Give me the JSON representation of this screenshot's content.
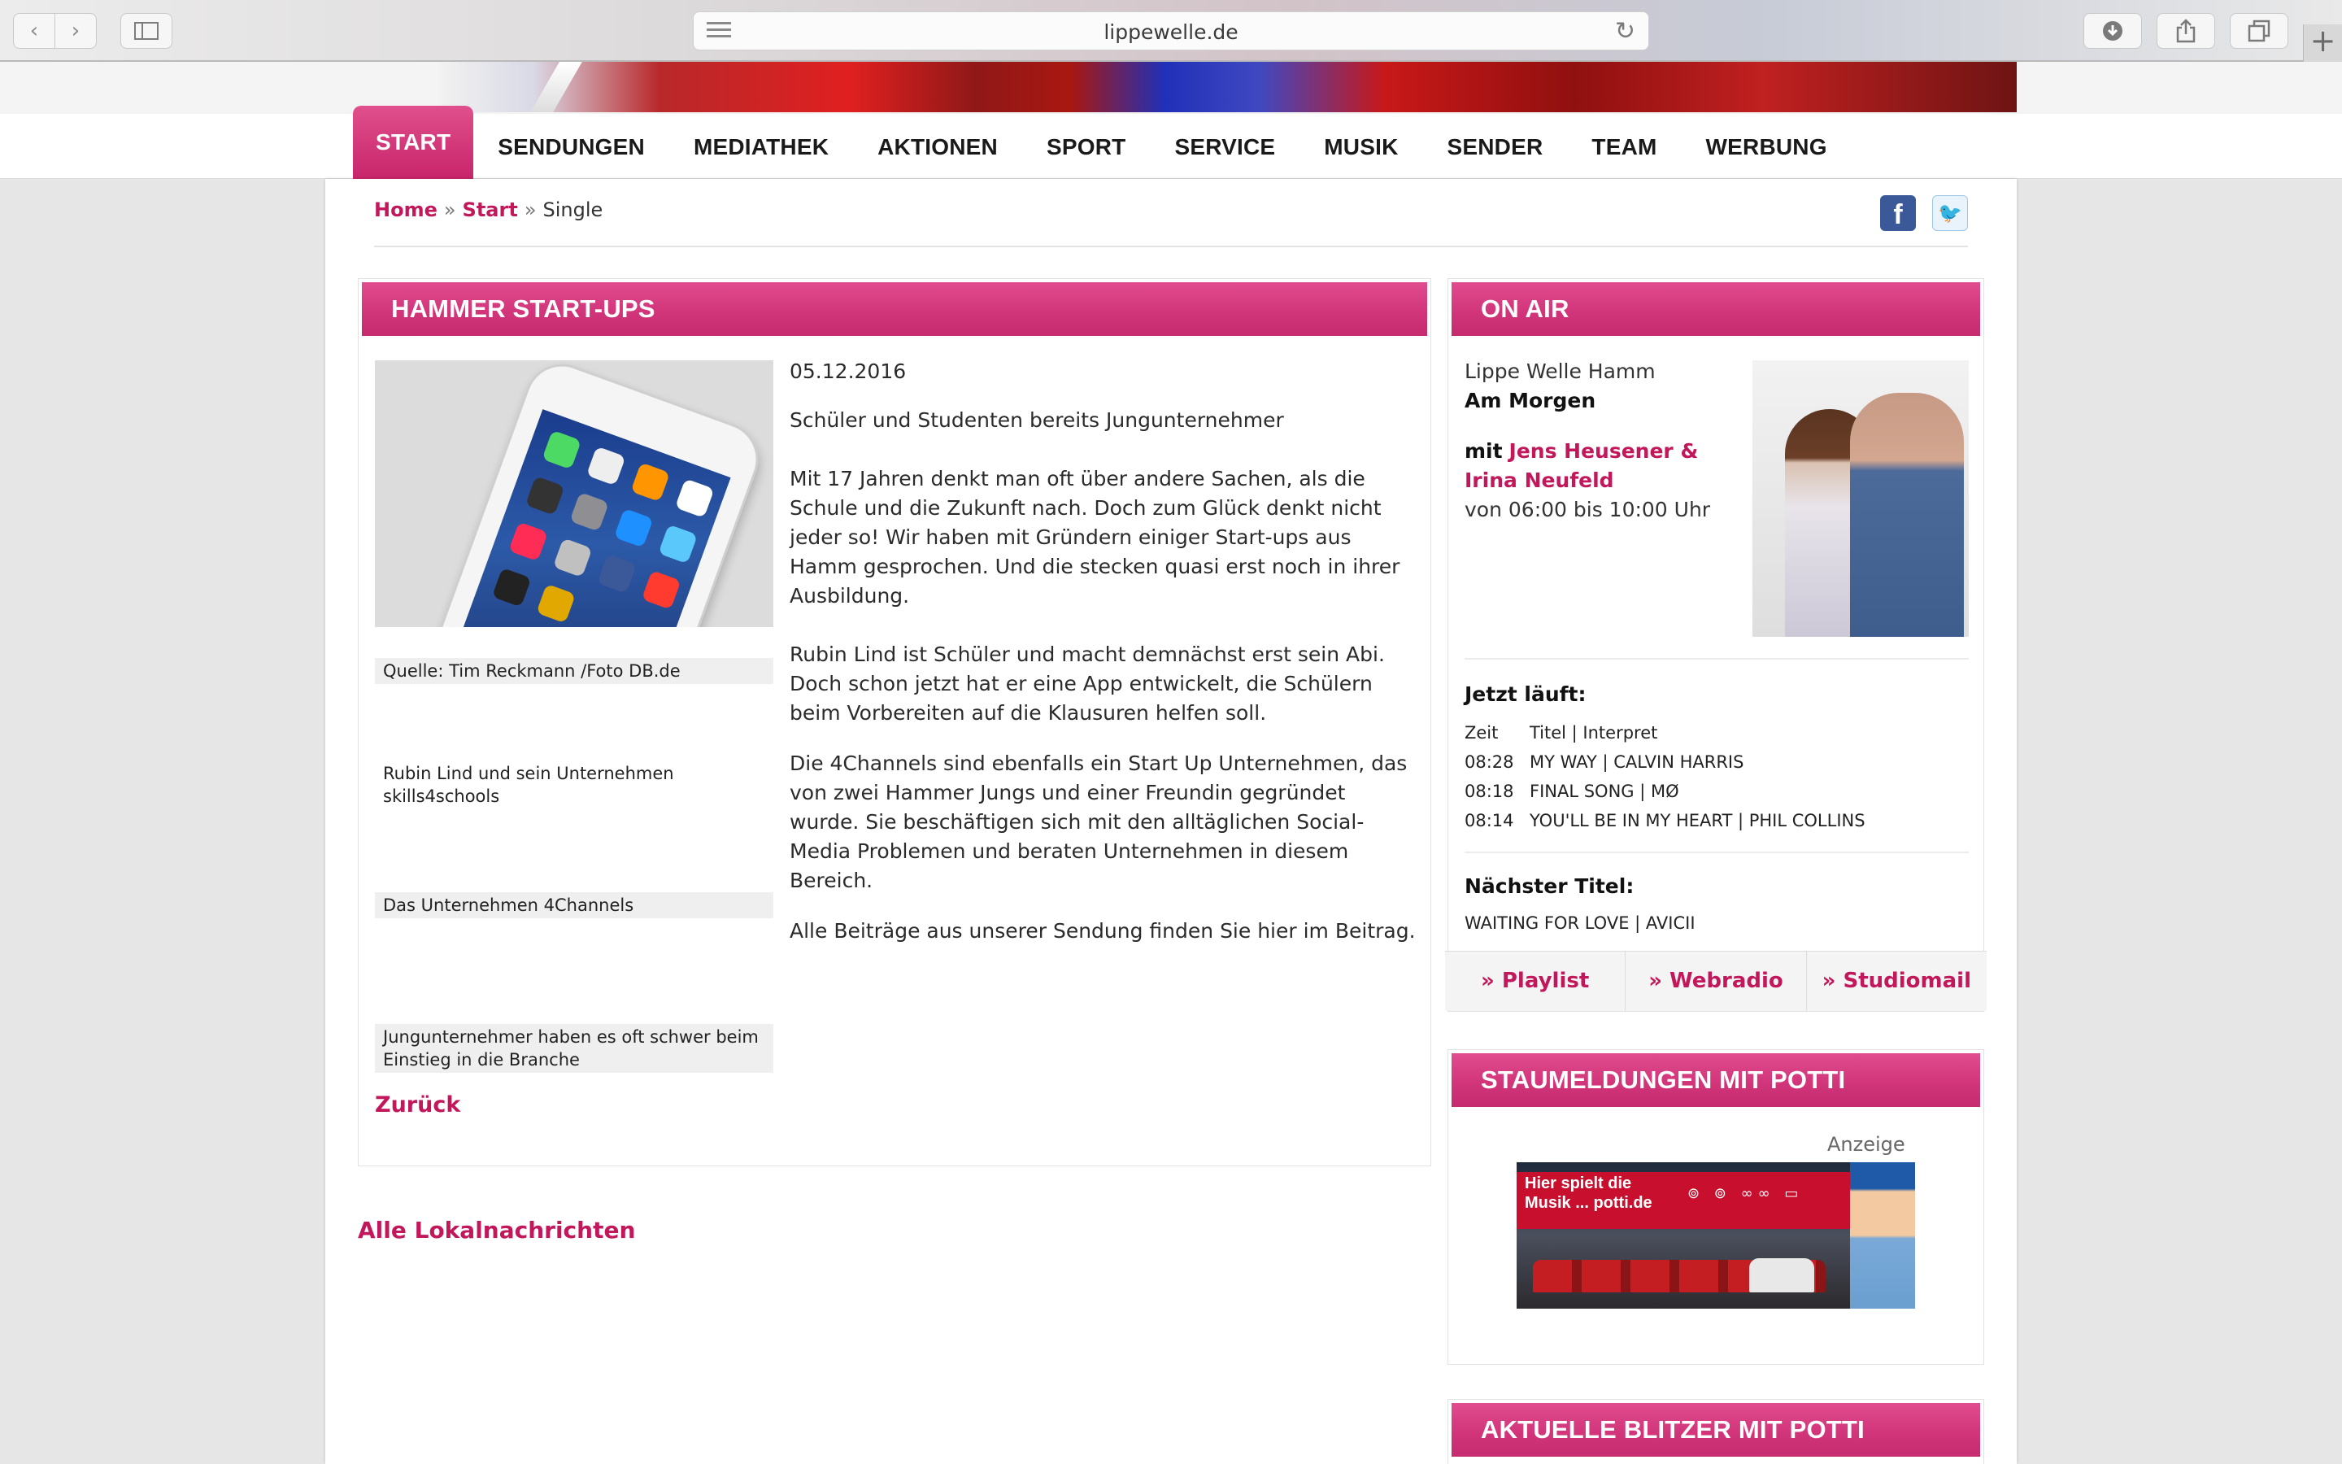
{
  "browser": {
    "url": "lippewelle.de"
  },
  "nav": {
    "items": [
      {
        "label": "START",
        "active": true
      },
      {
        "label": "SENDUNGEN"
      },
      {
        "label": "MEDIATHEK"
      },
      {
        "label": "AKTIONEN"
      },
      {
        "label": "SPORT"
      },
      {
        "label": "SERVICE"
      },
      {
        "label": "MUSIK"
      },
      {
        "label": "SENDER"
      },
      {
        "label": "TEAM"
      },
      {
        "label": "WERBUNG"
      }
    ]
  },
  "breadcrumb": {
    "home": "Home",
    "sep1": "»",
    "start": "Start",
    "sep2": "»",
    "current": "Single"
  },
  "social": {
    "facebook": "f",
    "twitter": "🐦"
  },
  "article": {
    "title": "HAMMER START-UPS",
    "date": "05.12.2016",
    "subtitle": "Schüler und Studenten bereits Jungunternehmer",
    "p1": "Mit 17 Jahren denkt man oft über andere Sachen, als die Schule und die Zukunft nach. Doch zum Glück denkt nicht jeder so! Wir haben mit Gründern einiger Start-ups aus Hamm gesprochen. Und die stecken quasi erst noch in ihrer Ausbildung.",
    "p2": "Rubin Lind ist Schüler und macht demnächst erst sein Abi. Doch schon jetzt hat er eine App entwickelt, die Schülern beim Vorbereiten auf die Klausuren helfen soll.",
    "p3": "Die 4Channels sind ebenfalls ein Start Up Unternehmen, das von zwei Hammer Jungs und einer Freundin gegründet wurde. Sie beschäftigen sich mit den alltäglichen Social- Media Problemen und beraten Unternehmen in diesem Bereich.",
    "p4": "Alle Beiträge aus unserer Sendung finden Sie hier im Beitrag.",
    "captions": [
      "Quelle: Tim Reckmann /Foto DB.de",
      "Rubin Lind und sein Unternehmen skills4schools",
      "Das Unternehmen 4Channels",
      "Jungunternehmer haben es oft schwer beim Einstieg in die Branche"
    ],
    "back": "Zurück"
  },
  "all_news": "Alle Lokalnachrichten",
  "onair": {
    "title": "ON AIR",
    "station": "Lippe Welle Hamm",
    "show": "Am Morgen",
    "with": "mit",
    "hosts": "Jens Heusener & Irina Neufeld",
    "time": "von 06:00 bis 10:00 Uhr",
    "now_label": "Jetzt läuft:",
    "header_time": "Zeit",
    "header_title": "Titel | Interpret",
    "songs": [
      {
        "time": "08:28",
        "title": "MY WAY | CALVIN HARRIS"
      },
      {
        "time": "08:18",
        "title": "FINAL SONG | MØ"
      },
      {
        "time": "08:14",
        "title": "YOU'LL BE IN MY HEART | PHIL COLLINS"
      }
    ],
    "next_label": "Nächster Titel:",
    "next_song": "WAITING FOR LOVE | AVICII",
    "links": [
      "» Playlist",
      "» Webradio",
      "» Studiomail"
    ]
  },
  "stau": {
    "title": "STAUMELDUNGEN MIT POTTI",
    "anzeige": "Anzeige",
    "ad_line1": "Hier spielt die",
    "ad_line2": "Musik ... potti.de"
  },
  "blitzer": {
    "title": "AKTUELLE BLITZER MIT POTTI"
  },
  "colors": {
    "accent": "#c2185b",
    "header_pink": "#d2357a"
  }
}
